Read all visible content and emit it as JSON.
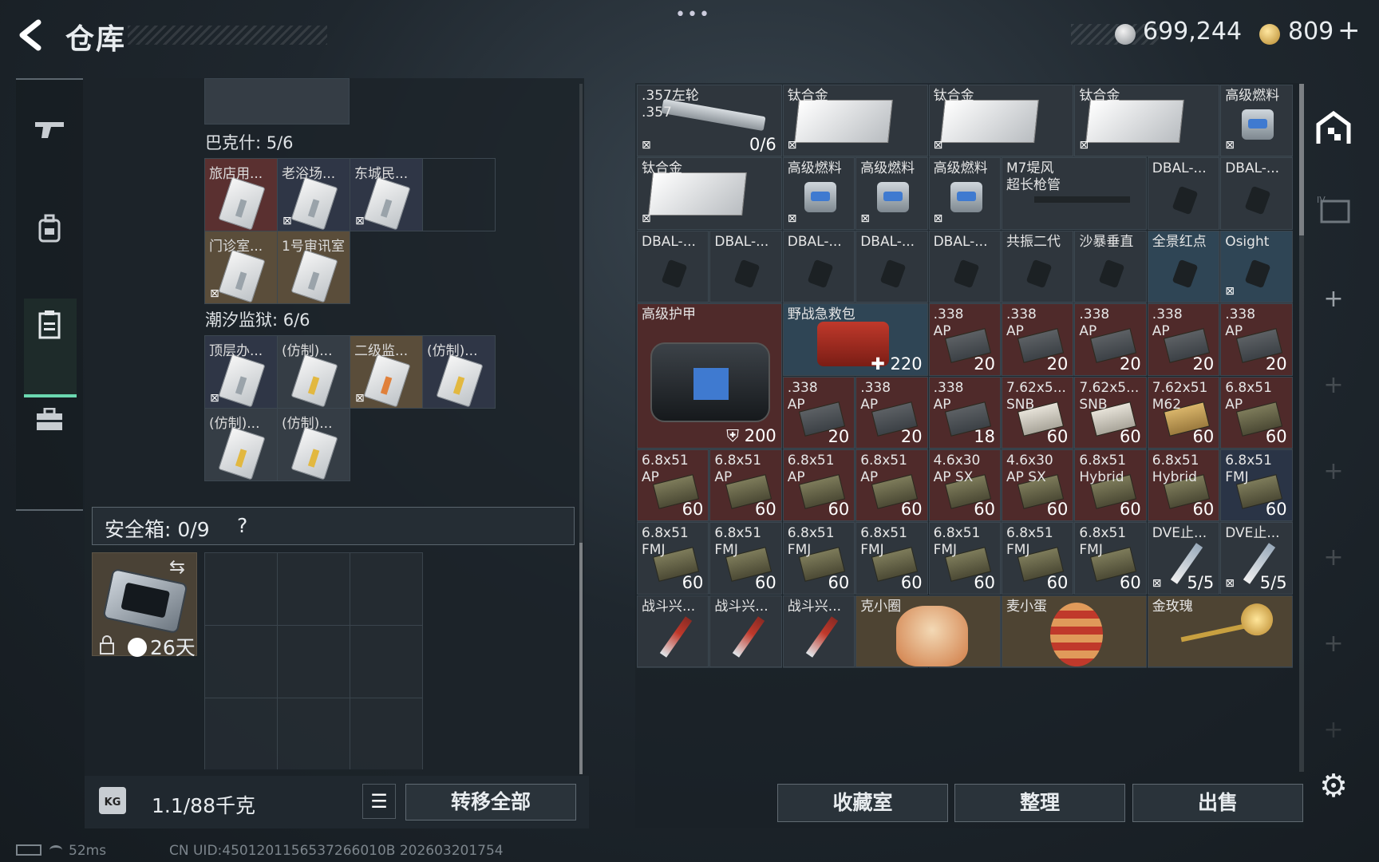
{
  "header": {
    "title": "仓库",
    "back_icon": "chevron-left-icon",
    "more_icon": "•••",
    "currency1": "699,244",
    "currency2": "809",
    "currency2_plus": "+"
  },
  "left_panel": {
    "top_section_title": "巴克什: 5/6",
    "bakesh_keys": [
      {
        "label": "旅店用...",
        "bg": "red"
      },
      {
        "label": "老浴场...",
        "bg": "navy",
        "no_insure": true
      },
      {
        "label": "东城民...",
        "bg": "navy",
        "no_insure": true
      },
      {
        "label": "",
        "bg": "empty"
      },
      {
        "label": "门诊室...",
        "bg": "tan",
        "no_insure": true
      },
      {
        "label": "1号审讯室",
        "bg": "tan"
      }
    ],
    "prison_section_title": "潮汐监狱: 6/6",
    "prison_keys": [
      {
        "label": "顶层办...",
        "bg": "navy",
        "no_insure": true
      },
      {
        "label": "(仿制)...",
        "bg": "gray",
        "color": "y"
      },
      {
        "label": "二级监...",
        "bg": "tan",
        "color": "o",
        "no_insure": true
      },
      {
        "label": "(仿制)...",
        "bg": "navy",
        "color": "y"
      },
      {
        "label": "(仿制)...",
        "bg": "gray",
        "color": "y"
      },
      {
        "label": "(仿制)...",
        "bg": "gray",
        "color": "y"
      }
    ],
    "safe_box_label": "安全箱: 0/9",
    "safe_box_help": "?",
    "case_days": "26天",
    "weight": "1.1/88千克",
    "weight_icon_text": "KG",
    "transfer_all": "转移全部"
  },
  "grid_items": [
    {
      "name": ".357左轮\n.357",
      "qty": "0/6",
      "bg": "gray",
      "kind": "gun",
      "nl": true
    },
    {
      "name": "钛合金",
      "bg": "gray",
      "kind": "metal",
      "nl": true
    },
    {
      "name": "钛合金",
      "bg": "gray",
      "kind": "metal",
      "nl": true
    },
    {
      "name": "钛合金",
      "bg": "gray",
      "kind": "metal",
      "nl": true
    },
    {
      "name": "高级燃料",
      "bg": "gray",
      "kind": "can",
      "nl": true
    },
    {
      "name": "钛合金",
      "bg": "gray",
      "kind": "metal",
      "nl": true
    },
    {
      "name": "高级燃料",
      "bg": "gray",
      "kind": "can",
      "nl": true
    },
    {
      "name": "高级燃料",
      "bg": "gray",
      "kind": "can",
      "nl": true
    },
    {
      "name": "高级燃料",
      "bg": "gray",
      "kind": "can",
      "nl": true
    },
    {
      "name": "M7堤风\n超长枪管",
      "bg": "gray",
      "kind": "barrel"
    },
    {
      "name": "DBAL-...",
      "bg": "gray",
      "kind": "mod"
    },
    {
      "name": "DBAL-...",
      "bg": "gray",
      "kind": "mod"
    },
    {
      "name": "DBAL-...",
      "bg": "gray",
      "kind": "mod"
    },
    {
      "name": "DBAL-...",
      "bg": "gray",
      "kind": "mod"
    },
    {
      "name": "DBAL-...",
      "bg": "gray",
      "kind": "mod"
    },
    {
      "name": "DBAL-...",
      "bg": "gray",
      "kind": "mod"
    },
    {
      "name": "DBAL-...",
      "bg": "gray",
      "kind": "mod"
    },
    {
      "name": "共振二代",
      "bg": "gray",
      "kind": "mod"
    },
    {
      "name": "沙暴垂直",
      "bg": "gray",
      "kind": "mod"
    },
    {
      "name": "全景红点",
      "bg": "blue",
      "kind": "mod"
    },
    {
      "name": "Osight",
      "bg": "blue",
      "kind": "mod",
      "nl": true
    },
    {
      "name": "高级护甲",
      "qty": "200",
      "bg": "red",
      "kind": "armor"
    },
    {
      "name": "野战急救包",
      "qty": "220",
      "bg": "blue",
      "kind": "medkit"
    },
    {
      "name": ".338\nAP",
      "qty": "20",
      "bg": "red",
      "kind": "ammo-box"
    },
    {
      "name": ".338\nAP",
      "qty": "20",
      "bg": "red",
      "kind": "ammo-box"
    },
    {
      "name": ".338\nAP",
      "qty": "20",
      "bg": "red",
      "kind": "ammo-box"
    },
    {
      "name": ".338\nAP",
      "qty": "20",
      "bg": "red",
      "kind": "ammo-box"
    },
    {
      "name": ".338\nAP",
      "qty": "20",
      "bg": "red",
      "kind": "ammo-box"
    },
    {
      "name": ".338\nAP",
      "qty": "20",
      "bg": "red",
      "kind": "ammo-box"
    },
    {
      "name": ".338\nAP",
      "qty": "20",
      "bg": "red",
      "kind": "ammo-box"
    },
    {
      "name": ".338\nAP",
      "qty": "18",
      "bg": "red",
      "kind": "ammo-box"
    },
    {
      "name": "7.62x5...\nSNB",
      "qty": "60",
      "bg": "red",
      "kind": "ammo-ctn"
    },
    {
      "name": "7.62x5...\nSNB",
      "qty": "60",
      "bg": "red",
      "kind": "ammo-ctn"
    },
    {
      "name": "7.62x51\nM62",
      "qty": "60",
      "bg": "red",
      "kind": "ammo-card"
    },
    {
      "name": "6.8x51\nAP",
      "qty": "60",
      "bg": "red",
      "kind": "ammo"
    },
    {
      "name": "6.8x51\nAP",
      "qty": "60",
      "bg": "red",
      "kind": "ammo"
    },
    {
      "name": "6.8x51\nAP",
      "qty": "60",
      "bg": "red",
      "kind": "ammo"
    },
    {
      "name": "6.8x51\nAP",
      "qty": "60",
      "bg": "red",
      "kind": "ammo"
    },
    {
      "name": "6.8x51\nAP",
      "qty": "60",
      "bg": "red",
      "kind": "ammo"
    },
    {
      "name": "4.6x30\nAP SX",
      "qty": "60",
      "bg": "red",
      "kind": "ammo"
    },
    {
      "name": "4.6x30\nAP SX",
      "qty": "60",
      "bg": "red",
      "kind": "ammo"
    },
    {
      "name": "6.8x51\nHybrid",
      "qty": "60",
      "bg": "red",
      "kind": "ammo"
    },
    {
      "name": "6.8x51\nHybrid",
      "qty": "60",
      "bg": "red",
      "kind": "ammo"
    },
    {
      "name": "6.8x51\nFMJ",
      "qty": "60",
      "bg": "navy",
      "kind": "ammo"
    },
    {
      "name": "6.8x51\nFMJ",
      "qty": "60",
      "bg": "gray",
      "kind": "ammo"
    },
    {
      "name": "6.8x51\nFMJ",
      "qty": "60",
      "bg": "gray",
      "kind": "ammo"
    },
    {
      "name": "6.8x51\nFMJ",
      "qty": "60",
      "bg": "gray",
      "kind": "ammo"
    },
    {
      "name": "6.8x51\nFMJ",
      "qty": "60",
      "bg": "gray",
      "kind": "ammo"
    },
    {
      "name": "6.8x51\nFMJ",
      "qty": "60",
      "bg": "gray",
      "kind": "ammo"
    },
    {
      "name": "6.8x51\nFMJ",
      "qty": "60",
      "bg": "gray",
      "kind": "ammo"
    },
    {
      "name": "6.8x51\nFMJ",
      "qty": "60",
      "bg": "gray",
      "kind": "ammo"
    },
    {
      "name": "DVE止...",
      "qty": "5/5",
      "bg": "gray",
      "kind": "injector",
      "nl": true
    },
    {
      "name": "DVE止...",
      "qty": "5/5",
      "bg": "gray",
      "kind": "injector",
      "nl": true
    },
    {
      "name": "战斗兴...",
      "bg": "gray",
      "kind": "syringe"
    },
    {
      "name": "战斗兴...",
      "bg": "gray",
      "kind": "syringe"
    },
    {
      "name": "战斗兴...",
      "bg": "gray",
      "kind": "syringe"
    },
    {
      "name": "克小圈",
      "bg": "tan",
      "kind": "figure"
    },
    {
      "name": "麦小蛋",
      "bg": "tan",
      "kind": "egg"
    },
    {
      "name": "金玫瑰",
      "bg": "tan",
      "kind": "rose"
    }
  ],
  "right_buttons": {
    "collection": "收藏室",
    "sort": "整理",
    "sell": "出售"
  },
  "status": {
    "ping": "52ms",
    "uid": "CN UID:4501201156537266010B 202603201754"
  },
  "icons": {
    "safe_swap": "⇆",
    "lock": "🔒",
    "clock": "◔",
    "gear": "⚙",
    "plus": "+",
    "list": "☰"
  }
}
